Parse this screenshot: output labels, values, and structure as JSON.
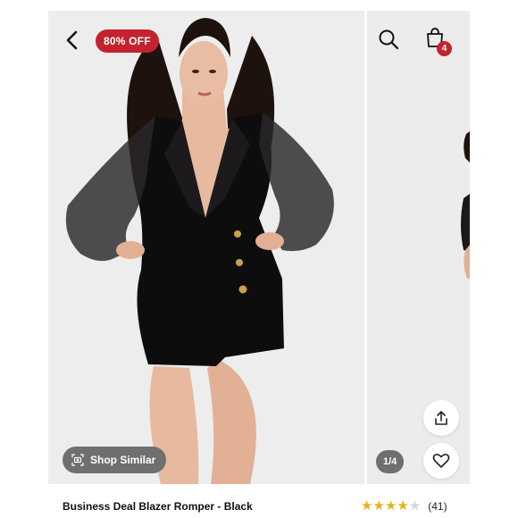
{
  "header": {
    "discount_badge": "80% OFF",
    "bag_count": "4"
  },
  "gallery": {
    "shop_similar_label": "Shop Similar",
    "page_counter": "1/4"
  },
  "product": {
    "title": "Business Deal Blazer Romper - Black",
    "rating_value": 4,
    "rating_max": 5,
    "review_count": "(41)"
  },
  "colors": {
    "accent_red": "#c3222e",
    "star_filled": "#e5b21f",
    "star_empty": "#d4d4d4",
    "pill_gray": "#6f6f6f"
  },
  "icons": [
    "back-arrow-icon",
    "search-icon",
    "shopping-bag-icon",
    "share-icon",
    "heart-icon",
    "similar-camera-icon",
    "star-icon"
  ]
}
